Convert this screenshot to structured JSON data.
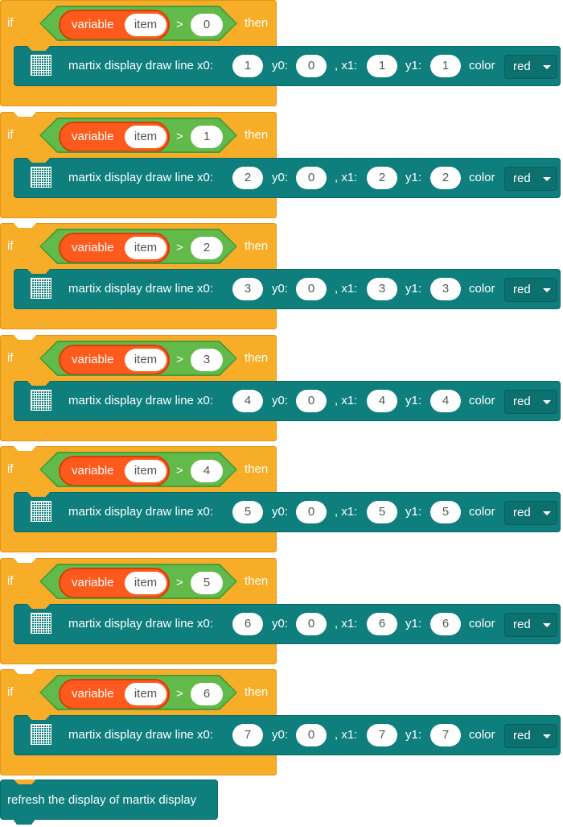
{
  "blocks": [
    {
      "if": "if",
      "variable": "variable",
      "item": "item",
      "op": ">",
      "threshold": "0",
      "then": "then",
      "line": {
        "label": "martix display draw line x0:",
        "x0": "1",
        "y0_label": "y0:",
        "y0": "0",
        "x1_label": ", x1:",
        "x1": "1",
        "y1_label": "y1:",
        "y1": "1",
        "color_label": "color",
        "color": "red"
      }
    },
    {
      "if": "if",
      "variable": "variable",
      "item": "item",
      "op": ">",
      "threshold": "1",
      "then": "then",
      "line": {
        "label": "martix display draw line x0:",
        "x0": "2",
        "y0_label": "y0:",
        "y0": "0",
        "x1_label": ", x1:",
        "x1": "2",
        "y1_label": "y1:",
        "y1": "2",
        "color_label": "color",
        "color": "red"
      }
    },
    {
      "if": "if",
      "variable": "variable",
      "item": "item",
      "op": ">",
      "threshold": "2",
      "then": "then",
      "line": {
        "label": "martix display draw line x0:",
        "x0": "3",
        "y0_label": "y0:",
        "y0": "0",
        "x1_label": ", x1:",
        "x1": "3",
        "y1_label": "y1:",
        "y1": "3",
        "color_label": "color",
        "color": "red"
      }
    },
    {
      "if": "if",
      "variable": "variable",
      "item": "item",
      "op": ">",
      "threshold": "3",
      "then": "then",
      "line": {
        "label": "martix display draw line x0:",
        "x0": "4",
        "y0_label": "y0:",
        "y0": "0",
        "x1_label": ", x1:",
        "x1": "4",
        "y1_label": "y1:",
        "y1": "4",
        "color_label": "color",
        "color": "red"
      }
    },
    {
      "if": "if",
      "variable": "variable",
      "item": "item",
      "op": ">",
      "threshold": "4",
      "then": "then",
      "line": {
        "label": "martix display draw line x0:",
        "x0": "5",
        "y0_label": "y0:",
        "y0": "0",
        "x1_label": ", x1:",
        "x1": "5",
        "y1_label": "y1:",
        "y1": "5",
        "color_label": "color",
        "color": "red"
      }
    },
    {
      "if": "if",
      "variable": "variable",
      "item": "item",
      "op": ">",
      "threshold": "5",
      "then": "then",
      "line": {
        "label": "martix display draw line x0:",
        "x0": "6",
        "y0_label": "y0:",
        "y0": "0",
        "x1_label": ", x1:",
        "x1": "6",
        "y1_label": "y1:",
        "y1": "6",
        "color_label": "color",
        "color": "red"
      }
    },
    {
      "if": "if",
      "variable": "variable",
      "item": "item",
      "op": ">",
      "threshold": "6",
      "then": "then",
      "line": {
        "label": "martix display draw line x0:",
        "x0": "7",
        "y0_label": "y0:",
        "y0": "0",
        "x1_label": ", x1:",
        "x1": "7",
        "y1_label": "y1:",
        "y1": "7",
        "color_label": "color",
        "color": "red"
      }
    }
  ],
  "refresh": {
    "label": "refresh the display of martix display"
  },
  "colors": {
    "control": "#f8ad28",
    "operator": "#61ba4a",
    "variable": "#ff5a1e",
    "extension": "#0e7f7d"
  },
  "icons": {
    "draw_block": "matrix-grid-icon",
    "dropdown": "caret-down-icon"
  }
}
